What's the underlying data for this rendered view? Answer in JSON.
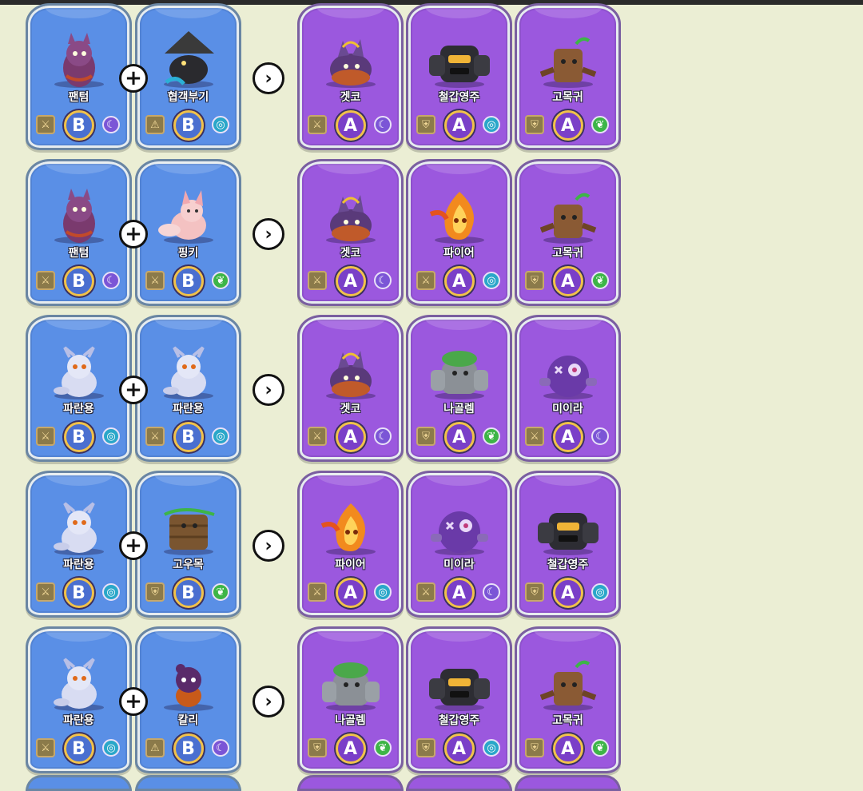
{
  "rows": [
    {
      "inputs": [
        {
          "name": "팬텀",
          "grade": "B",
          "slot_icon": "sword-icon",
          "element": "moon",
          "art": "phantom"
        },
        {
          "name": "협객부기",
          "grade": "B",
          "slot_icon": "warning-icon",
          "element": "water",
          "art": "swordsman"
        }
      ],
      "outputs": [
        {
          "name": "겟코",
          "grade": "A",
          "slot_icon": "sword-icon",
          "element": "moon",
          "art": "gecko"
        },
        {
          "name": "철갑영주",
          "grade": "A",
          "slot_icon": "shield-icon",
          "element": "water",
          "art": "ironlord"
        },
        {
          "name": "고목귀",
          "grade": "A",
          "slot_icon": "shield-icon",
          "element": "leaf",
          "art": "treant"
        }
      ]
    },
    {
      "inputs": [
        {
          "name": "팬텀",
          "grade": "B",
          "slot_icon": "sword-icon",
          "element": "moon",
          "art": "phantom"
        },
        {
          "name": "핑키",
          "grade": "B",
          "slot_icon": "sword-icon",
          "element": "leaf",
          "art": "fox"
        }
      ],
      "outputs": [
        {
          "name": "겟코",
          "grade": "A",
          "slot_icon": "sword-icon",
          "element": "moon",
          "art": "gecko"
        },
        {
          "name": "파이어",
          "grade": "A",
          "slot_icon": "sword-icon",
          "element": "water",
          "art": "fire"
        },
        {
          "name": "고목귀",
          "grade": "A",
          "slot_icon": "shield-icon",
          "element": "leaf",
          "art": "treant"
        }
      ]
    },
    {
      "inputs": [
        {
          "name": "파란용",
          "grade": "B",
          "slot_icon": "sword-icon",
          "element": "water",
          "art": "dragon"
        },
        {
          "name": "파란용",
          "grade": "B",
          "slot_icon": "sword-icon",
          "element": "water",
          "art": "dragon"
        }
      ],
      "outputs": [
        {
          "name": "겟코",
          "grade": "A",
          "slot_icon": "sword-icon",
          "element": "moon",
          "art": "gecko"
        },
        {
          "name": "나골렘",
          "grade": "A",
          "slot_icon": "shield-icon",
          "element": "leaf",
          "art": "golem"
        },
        {
          "name": "미이라",
          "grade": "A",
          "slot_icon": "sword-icon",
          "element": "moon",
          "art": "mummy"
        }
      ]
    },
    {
      "inputs": [
        {
          "name": "파란용",
          "grade": "B",
          "slot_icon": "sword-icon",
          "element": "water",
          "art": "dragon"
        },
        {
          "name": "고우목",
          "grade": "B",
          "slot_icon": "shield-icon",
          "element": "leaf",
          "art": "woodbox"
        }
      ],
      "outputs": [
        {
          "name": "파이어",
          "grade": "A",
          "slot_icon": "sword-icon",
          "element": "water",
          "art": "fire"
        },
        {
          "name": "미이라",
          "grade": "A",
          "slot_icon": "sword-icon",
          "element": "moon",
          "art": "mummy"
        },
        {
          "name": "철갑영주",
          "grade": "A",
          "slot_icon": "shield-icon",
          "element": "water",
          "art": "ironlord"
        }
      ]
    },
    {
      "inputs": [
        {
          "name": "파란용",
          "grade": "B",
          "slot_icon": "sword-icon",
          "element": "water",
          "art": "dragon"
        },
        {
          "name": "칼리",
          "grade": "B",
          "slot_icon": "warning-icon",
          "element": "moon",
          "art": "kali"
        }
      ],
      "outputs": [
        {
          "name": "나골렘",
          "grade": "A",
          "slot_icon": "shield-icon",
          "element": "leaf",
          "art": "golem"
        },
        {
          "name": "철갑영주",
          "grade": "A",
          "slot_icon": "shield-icon",
          "element": "water",
          "art": "ironlord"
        },
        {
          "name": "고목귀",
          "grade": "A",
          "slot_icon": "shield-icon",
          "element": "leaf",
          "art": "treant"
        }
      ]
    }
  ],
  "symbols": {
    "plus": "+",
    "arrow": "›"
  }
}
